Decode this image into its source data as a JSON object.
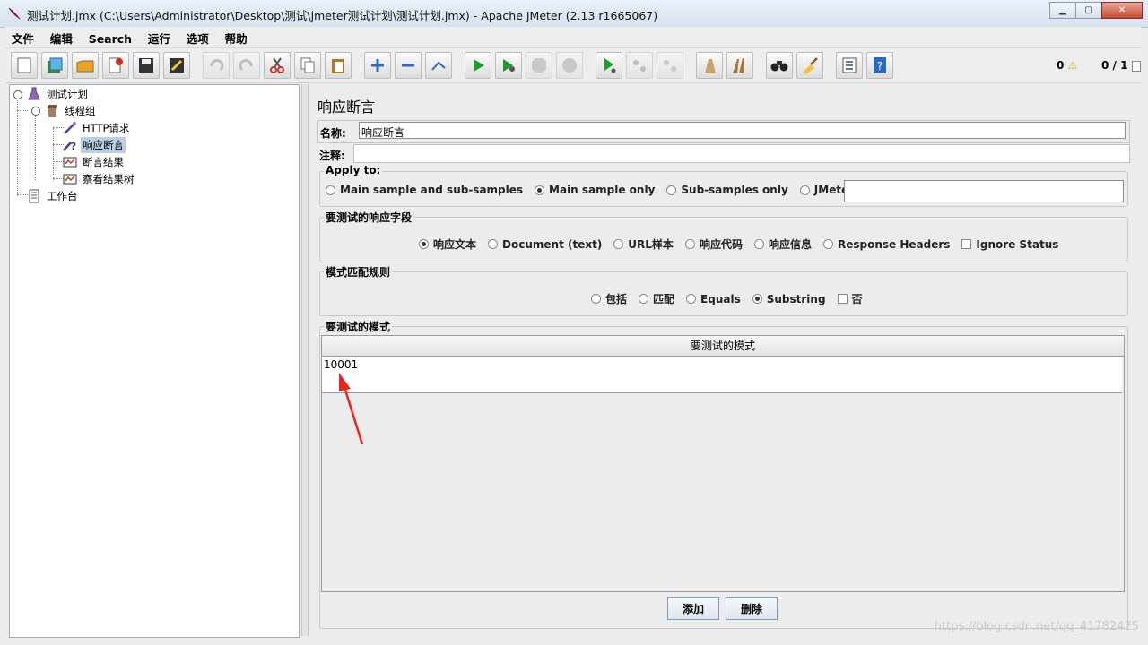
{
  "window": {
    "title": "测试计划.jmx (C:\\Users\\Administrator\\Desktop\\测试\\jmeter测试计划\\测试计划.jmx) - Apache JMeter (2.13 r1665067)",
    "controls": [
      "minimize-icon",
      "maximize-icon",
      "close-icon"
    ]
  },
  "menu": [
    "文件",
    "编辑",
    "Search",
    "运行",
    "选项",
    "帮助"
  ],
  "toolbar": {
    "buttons": [
      "new-icon",
      "templates-icon",
      "open-icon",
      "close-plan-icon",
      "save-icon",
      "save-as-icon",
      "undo-icon",
      "redo-icon",
      "cut-icon",
      "copy-icon",
      "paste-icon",
      "expand-icon",
      "collapse-icon",
      "toggle-icon",
      "start-icon",
      "start-no-pause-icon",
      "stop-icon",
      "shutdown-icon",
      "remote-start-icon",
      "remote-stop-icon",
      "remote-shutdown-icon",
      "clear-icon",
      "clear-all-icon",
      "search-icon",
      "reset-search-icon",
      "function-helper-icon",
      "help-icon"
    ],
    "error_count": "0",
    "threads": "0 / 1"
  },
  "tree": {
    "nodes": [
      {
        "label": "测试计划",
        "icon": "test-plan-icon"
      },
      {
        "label": "线程组",
        "icon": "thread-group-icon"
      },
      {
        "label": "HTTP请求",
        "icon": "http-sampler-icon"
      },
      {
        "label": "响应断言",
        "icon": "assertion-icon"
      },
      {
        "label": "断言结果",
        "icon": "listener-icon"
      },
      {
        "label": "察看结果树",
        "icon": "listener-icon"
      },
      {
        "label": "工作台",
        "icon": "workbench-icon"
      }
    ]
  },
  "panel": {
    "title": "响应断言",
    "name_label": "名称:",
    "name_value": "响应断言",
    "comment_label": "注释:",
    "comment_value": "",
    "apply_to": {
      "title": "Apply to:",
      "options": [
        "Main sample and sub-samples",
        "Main sample only",
        "Sub-samples only",
        "JMeter Variable"
      ],
      "selected": "Main sample only",
      "variable_value": ""
    },
    "field": {
      "title": "要测试的响应字段",
      "options": [
        "响应文本",
        "Document (text)",
        "URL样本",
        "响应代码",
        "响应信息",
        "Response Headers"
      ],
      "selected": "响应文本",
      "ignore_status_label": "Ignore Status",
      "ignore_status": false
    },
    "rule": {
      "title": "模式匹配规则",
      "options": [
        "包括",
        "匹配",
        "Equals",
        "Substring"
      ],
      "selected": "Substring",
      "not_label": "否",
      "not_checked": false
    },
    "patterns": {
      "title": "要测试的模式",
      "column": "要测试的模式",
      "rows": [
        "10001"
      ]
    },
    "add_label": "添加",
    "delete_label": "删除"
  },
  "watermark": "https://blog.csdn.net/qq_41782425",
  "colors": {
    "annotation_arrow": "#e8261c",
    "selection": "#b8cfe5"
  }
}
